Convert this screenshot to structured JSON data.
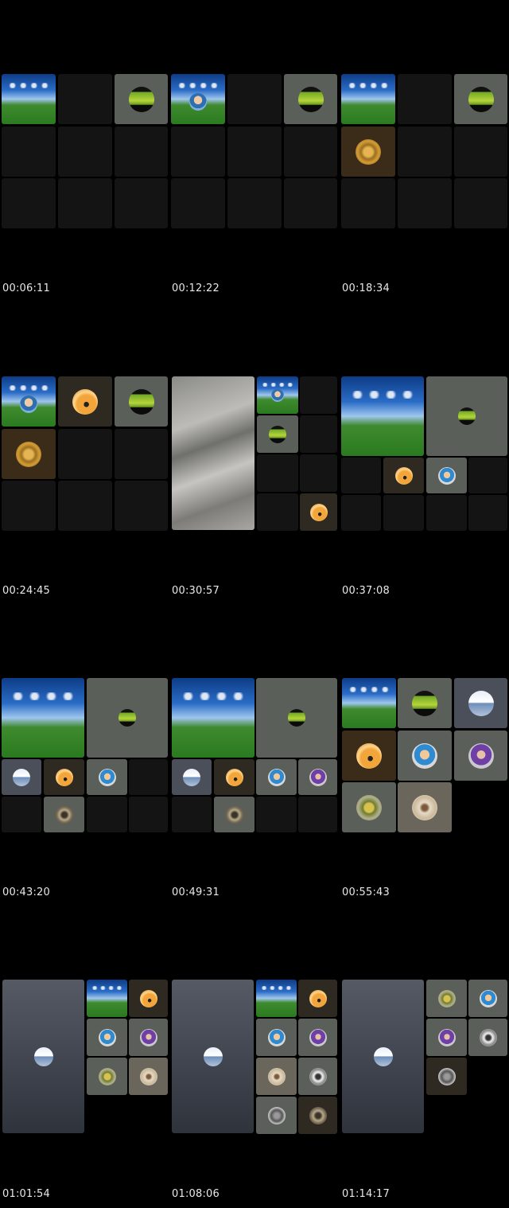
{
  "timestamps": [
    "00:06:11",
    "00:12:22",
    "00:18:34",
    "00:24:45",
    "00:30:57",
    "00:37:08",
    "00:43:20",
    "00:49:31",
    "00:55:43",
    "01:01:54",
    "01:08:06",
    "01:14:17"
  ]
}
